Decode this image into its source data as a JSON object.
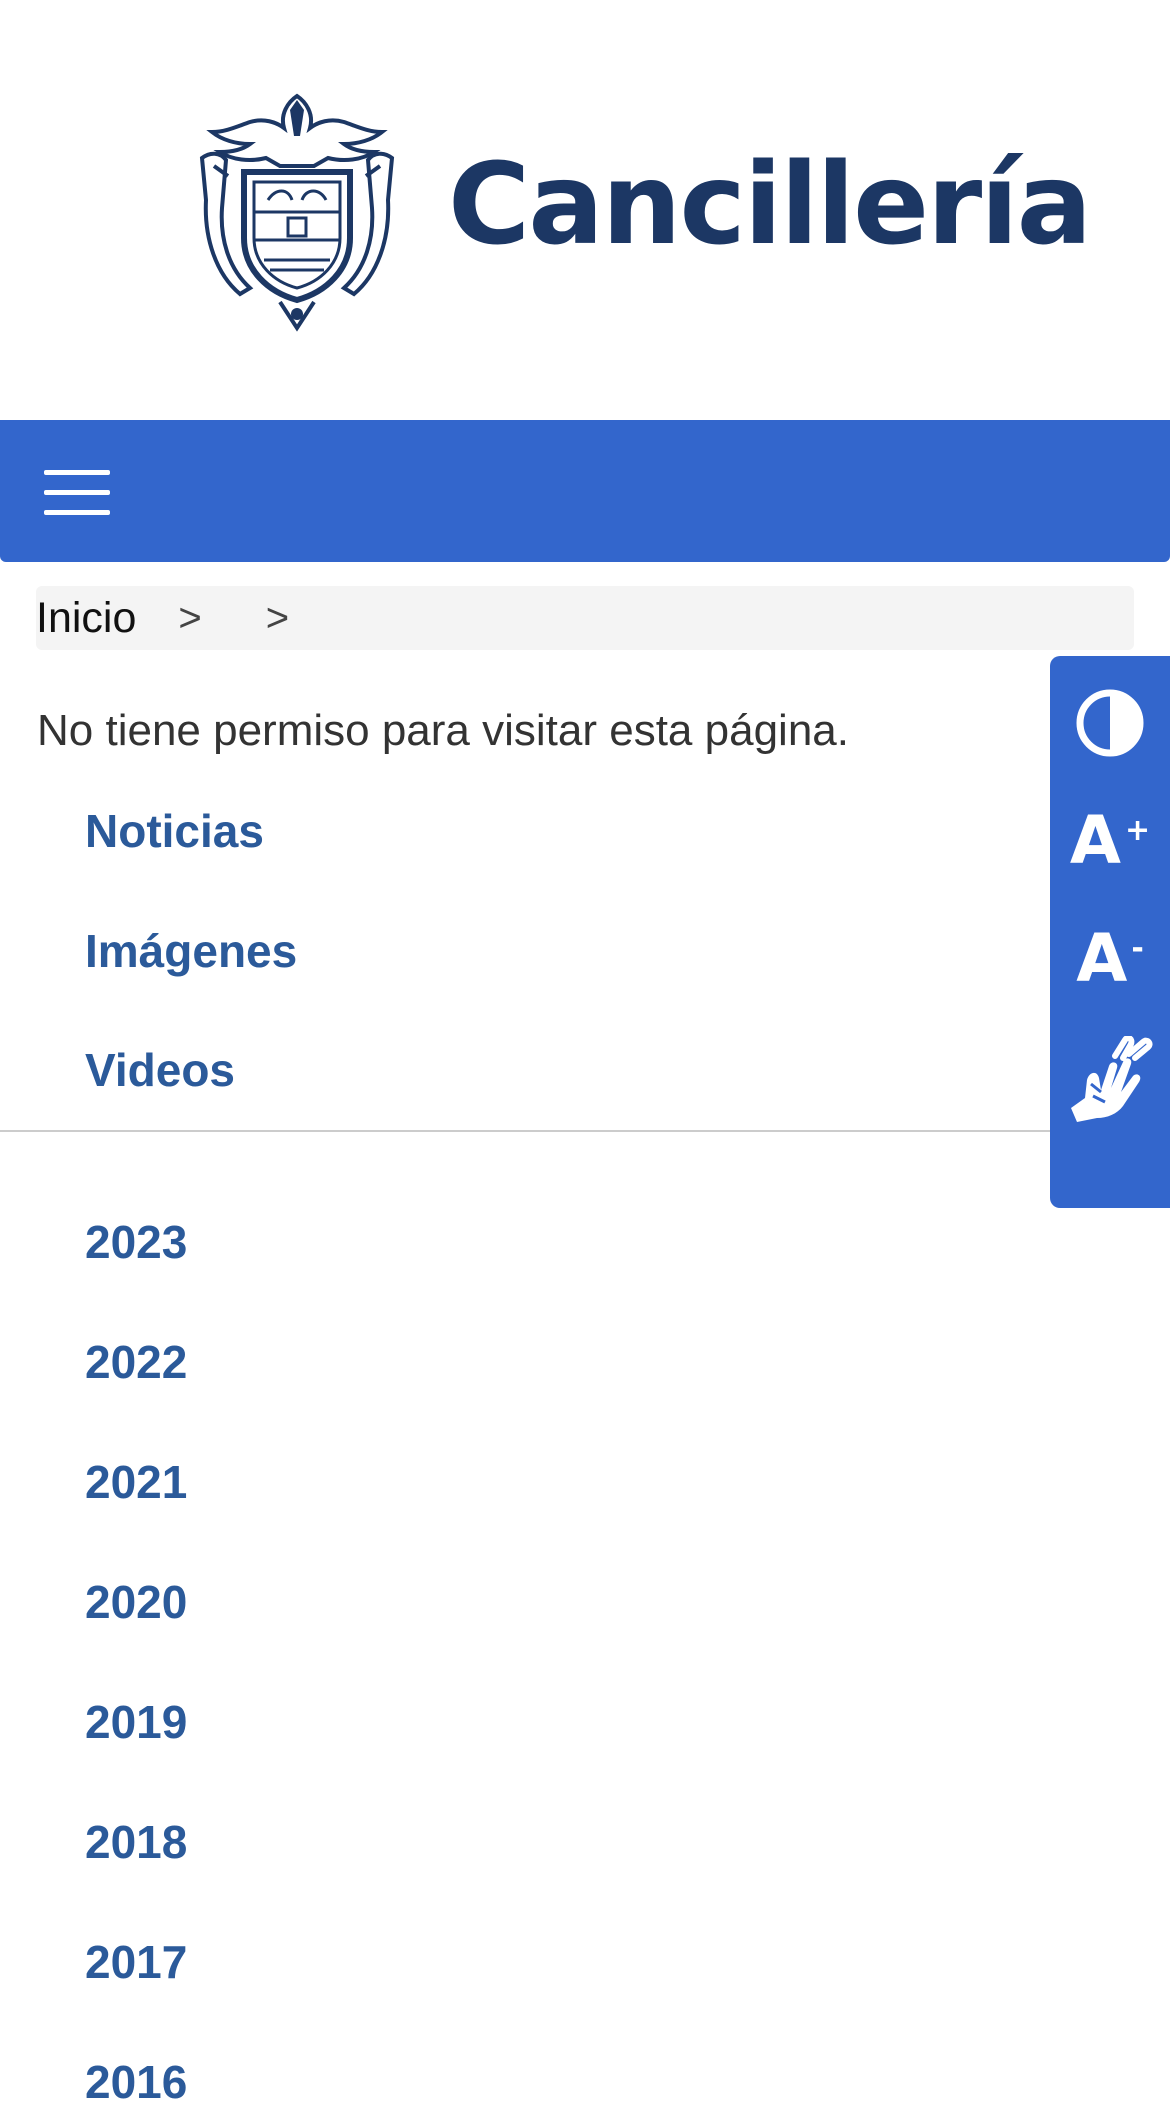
{
  "header": {
    "logo_text": "Cancillería"
  },
  "navbar": {
    "menu_icon": "hamburger-menu-icon",
    "color": "#3366cc"
  },
  "breadcrumb": {
    "home": "Inicio",
    "separator_1": ">",
    "separator_2": ">"
  },
  "main": {
    "message": "No tiene permiso para visitar esta página.",
    "links": [
      "Noticias",
      "Imágenes",
      "Videos"
    ],
    "years": [
      "2023",
      "2022",
      "2021",
      "2020",
      "2019",
      "2018",
      "2017",
      "2016"
    ]
  },
  "accessibility": {
    "contrast_icon": "contrast-icon",
    "increase_font_label": "A",
    "increase_font_symbol": "+",
    "decrease_font_label": "A",
    "decrease_font_symbol": "-",
    "sign_language_icon": "sign-language-icon"
  },
  "colors": {
    "brand_blue": "#3366cc",
    "link_blue": "#2b5a9a",
    "logo_navy": "#1c3764"
  }
}
